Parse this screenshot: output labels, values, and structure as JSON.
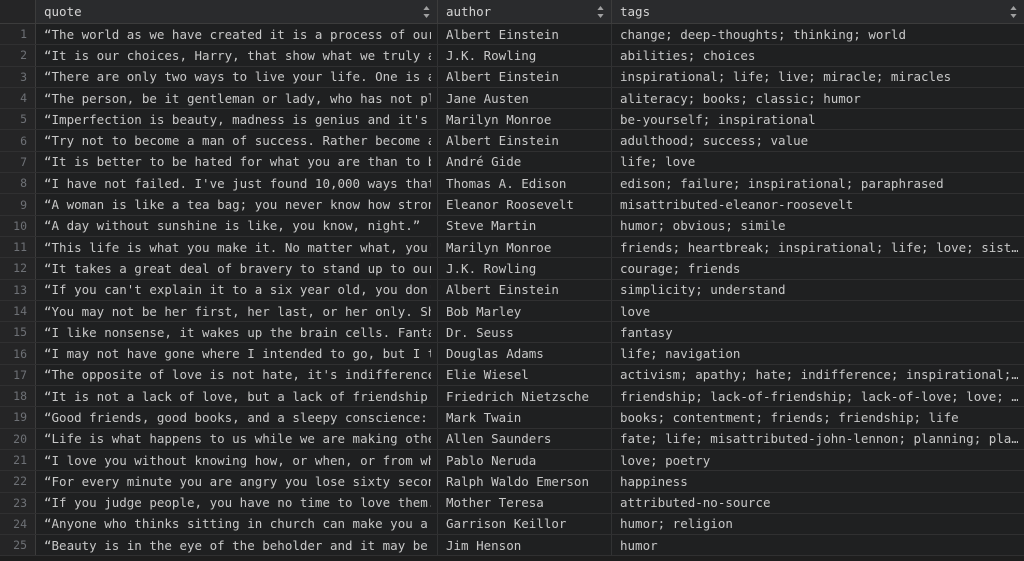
{
  "table": {
    "columns": [
      {
        "key": "quote",
        "label": "quote",
        "sort_icon": "sort-updown-icon"
      },
      {
        "key": "author",
        "label": "author",
        "sort_icon": "sort-updown-icon"
      },
      {
        "key": "tags",
        "label": "tags",
        "sort_icon": "sort-updown-icon"
      }
    ],
    "row_count_visible": 25,
    "colors": {
      "background": "#1e1e1e",
      "row_background": "#1f2021",
      "gutter_background": "#252526",
      "header_background": "#2a2b2d",
      "grid_line": "#303031",
      "text": "#c8c8c8",
      "header_text": "#d4d4d4",
      "row_number_text": "#6e7176"
    },
    "rows": [
      {
        "n": "1",
        "quote": "“The world as we have created it is a process of our…",
        "author": "Albert Einstein",
        "tags": "change; deep-thoughts; thinking; world"
      },
      {
        "n": "2",
        "quote": "“It is our choices, Harry, that show what we truly a…",
        "author": "J.K. Rowling",
        "tags": "abilities; choices"
      },
      {
        "n": "3",
        "quote": "“There are only two ways to live your life. One is a…",
        "author": "Albert Einstein",
        "tags": "inspirational; life; live; miracle; miracles"
      },
      {
        "n": "4",
        "quote": "“The person, be it gentleman or lady, who has not pl…",
        "author": "Jane Austen",
        "tags": "aliteracy; books; classic; humor"
      },
      {
        "n": "5",
        "quote": "“Imperfection is beauty, madness is genius and it's …",
        "author": "Marilyn Monroe",
        "tags": "be-yourself; inspirational"
      },
      {
        "n": "6",
        "quote": "“Try not to become a man of success. Rather become a…",
        "author": "Albert Einstein",
        "tags": "adulthood; success; value"
      },
      {
        "n": "7",
        "quote": "“It is better to be hated for what you are than to b…",
        "author": "André Gide",
        "tags": "life; love"
      },
      {
        "n": "8",
        "quote": "“I have not failed. I've just found 10,000 ways that…",
        "author": "Thomas A. Edison",
        "tags": "edison; failure; inspirational; paraphrased"
      },
      {
        "n": "9",
        "quote": "“A woman is like a tea bag; you never know how stron…",
        "author": "Eleanor Roosevelt",
        "tags": "misattributed-eleanor-roosevelt"
      },
      {
        "n": "10",
        "quote": "“A day without sunshine is like, you know, night.”",
        "author": "Steve Martin",
        "tags": "humor; obvious; simile"
      },
      {
        "n": "11",
        "quote": "“This life is what you make it. No matter what, you'…",
        "author": "Marilyn Monroe",
        "tags": "friends; heartbreak; inspirational; life; love; sist…"
      },
      {
        "n": "12",
        "quote": "“It takes a great deal of bravery to stand up to our…",
        "author": "J.K. Rowling",
        "tags": "courage; friends"
      },
      {
        "n": "13",
        "quote": "“If you can't explain it to a six year old, you don'…",
        "author": "Albert Einstein",
        "tags": "simplicity; understand"
      },
      {
        "n": "14",
        "quote": "“You may not be her first, her last, or her only. Sh…",
        "author": "Bob Marley",
        "tags": "love"
      },
      {
        "n": "15",
        "quote": "“I like nonsense, it wakes up the brain cells. Fanta…",
        "author": "Dr. Seuss",
        "tags": "fantasy"
      },
      {
        "n": "16",
        "quote": "“I may not have gone where I intended to go, but I t…",
        "author": "Douglas Adams",
        "tags": "life; navigation"
      },
      {
        "n": "17",
        "quote": "“The opposite of love is not hate, it's indifference…",
        "author": "Elie Wiesel",
        "tags": "activism; apathy; hate; indifference; inspirational;…"
      },
      {
        "n": "18",
        "quote": "“It is not a lack of love, but a lack of friendship …",
        "author": "Friedrich Nietzsche",
        "tags": "friendship; lack-of-friendship; lack-of-love; love; …"
      },
      {
        "n": "19",
        "quote": "“Good friends, good books, and a sleepy conscience: …",
        "author": "Mark Twain",
        "tags": "books; contentment; friends; friendship; life"
      },
      {
        "n": "20",
        "quote": "“Life is what happens to us while we are making othe…",
        "author": "Allen Saunders",
        "tags": "fate; life; misattributed-john-lennon; planning; pla…"
      },
      {
        "n": "21",
        "quote": "“I love you without knowing how, or when, or from wh…",
        "author": "Pablo Neruda",
        "tags": "love; poetry"
      },
      {
        "n": "22",
        "quote": "“For every minute you are angry you lose sixty secon…",
        "author": "Ralph Waldo Emerson",
        "tags": "happiness"
      },
      {
        "n": "23",
        "quote": "“If you judge people, you have no time to love them.”",
        "author": "Mother Teresa",
        "tags": "attributed-no-source"
      },
      {
        "n": "24",
        "quote": "“Anyone who thinks sitting in church can make you a …",
        "author": "Garrison Keillor",
        "tags": "humor; religion"
      },
      {
        "n": "25",
        "quote": "“Beauty is in the eye of the beholder and it may be …",
        "author": "Jim Henson",
        "tags": "humor"
      }
    ]
  }
}
